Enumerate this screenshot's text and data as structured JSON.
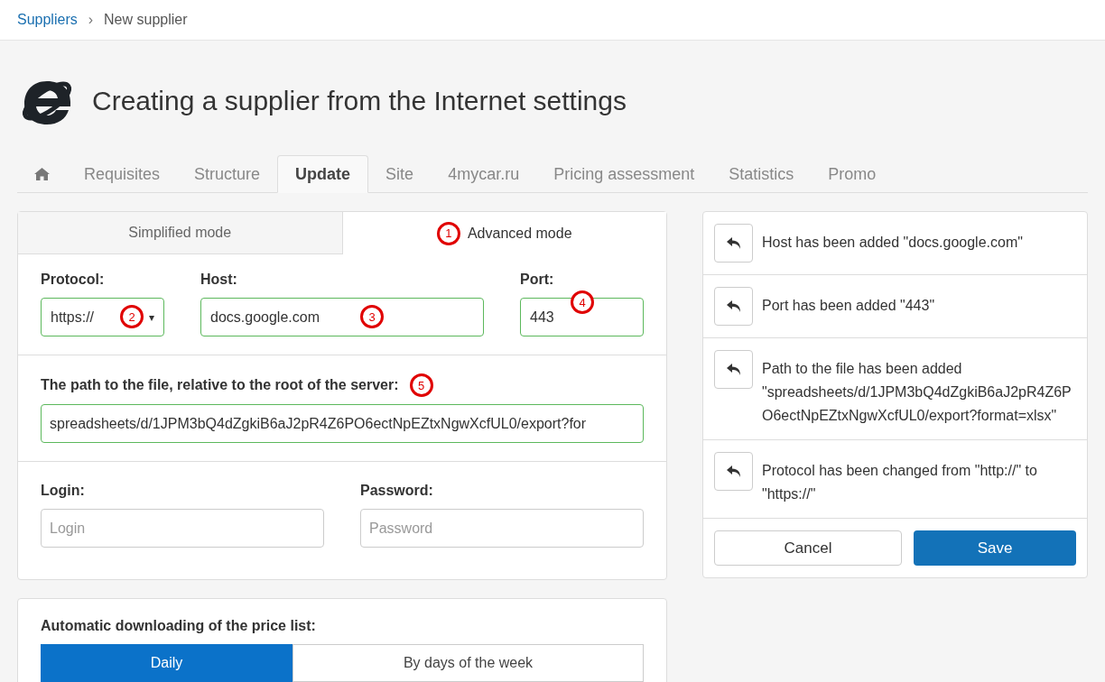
{
  "breadcrumb": {
    "link": "Suppliers",
    "separator": "›",
    "current": "New supplier"
  },
  "title": "Creating a supplier from the Internet settings",
  "tabs": [
    {
      "kind": "home",
      "selected": false
    },
    {
      "kind": "text",
      "label": "Requisites",
      "selected": false
    },
    {
      "kind": "text",
      "label": "Structure",
      "selected": false
    },
    {
      "kind": "text",
      "label": "Update",
      "selected": true
    },
    {
      "kind": "text",
      "label": "Site",
      "selected": false
    },
    {
      "kind": "text",
      "label": "4mycar.ru",
      "selected": false
    },
    {
      "kind": "text",
      "label": "Pricing assessment",
      "selected": false
    },
    {
      "kind": "text",
      "label": "Statistics",
      "selected": false
    },
    {
      "kind": "text",
      "label": "Promo",
      "selected": false
    }
  ],
  "mode_tabs": [
    {
      "label": "Simplified mode",
      "selected": false
    },
    {
      "label": "Advanced mode",
      "selected": true,
      "marker": "1"
    }
  ],
  "protocol": {
    "label": "Protocol:",
    "value": "https://",
    "caret": "▾",
    "marker": "2"
  },
  "host": {
    "label": "Host:",
    "value": "docs.google.com",
    "marker": "3"
  },
  "port": {
    "label": "Port:",
    "value": "443",
    "marker": "4"
  },
  "path": {
    "label": "The path to the file, relative to the root of the server:",
    "value": "spreadsheets/d/1JPM3bQ4dZgkiB6aJ2pR4Z6PO6ectNpEZtxNgwXcfUL0/export?for",
    "marker": "5"
  },
  "login": {
    "label": "Login:",
    "placeholder": "Login"
  },
  "password": {
    "label": "Password:",
    "placeholder": "Password"
  },
  "auto_download": {
    "label": "Automatic downloading of the price list:",
    "options": [
      {
        "label": "Daily",
        "selected": true
      },
      {
        "label": "By days of the week",
        "selected": false
      }
    ]
  },
  "changes": [
    {
      "text": "Host has been added \"docs.google.com\""
    },
    {
      "text": "Port has been added \"443\""
    },
    {
      "text": "Path to the file has been added \"spreadsheets/d/1JPM3bQ4dZgkiB6aJ2pR4Z6PO6ectNpEZtxNgwXcfUL0/export?format=xlsx\""
    },
    {
      "text": "Protocol has been changed from \"http://\" to \"https://\""
    }
  ],
  "buttons": {
    "cancel": "Cancel",
    "save": "Save"
  }
}
